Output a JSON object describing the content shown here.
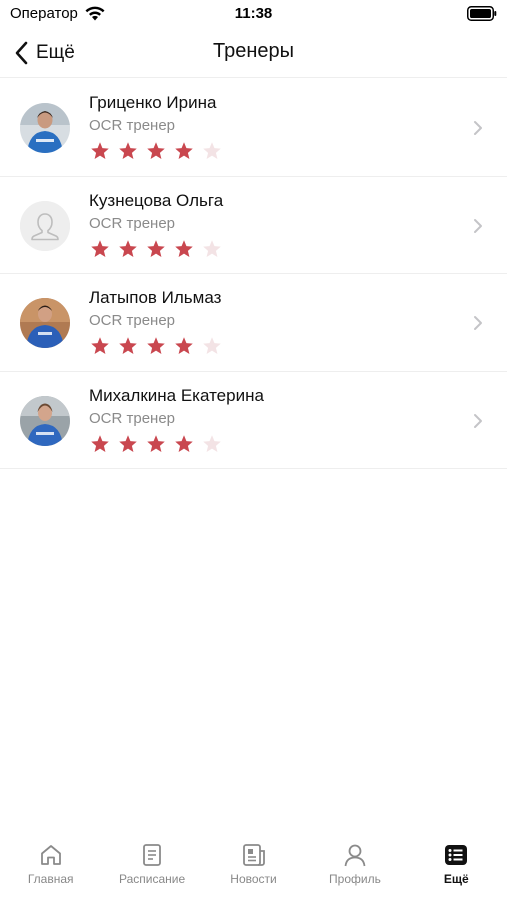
{
  "status_bar": {
    "carrier": "Оператор",
    "time": "11:38"
  },
  "nav": {
    "back_label": "Ещё",
    "title": "Тренеры"
  },
  "colors": {
    "star_filled": "#c9474f",
    "star_empty": "#f3e3e5",
    "divider": "#eeeeee",
    "secondary_text": "#8a8a8a"
  },
  "trainers": [
    {
      "name": "Гриценко Ирина",
      "role": "OCR тренер",
      "rating": 4,
      "max_rating": 5,
      "avatar": "photo"
    },
    {
      "name": "Кузнецова Ольга",
      "role": "OCR тренер",
      "rating": 4,
      "max_rating": 5,
      "avatar": "placeholder-person-icon"
    },
    {
      "name": "Латыпов Ильмаз",
      "role": "OCR тренер",
      "rating": 4,
      "max_rating": 5,
      "avatar": "photo"
    },
    {
      "name": "Михалкина Екатерина",
      "role": "OCR тренер",
      "rating": 4,
      "max_rating": 5,
      "avatar": "photo"
    }
  ],
  "tab_bar": {
    "tabs": [
      {
        "label": "Главная",
        "icon": "home-icon",
        "active": false
      },
      {
        "label": "Расписание",
        "icon": "schedule-icon",
        "active": false
      },
      {
        "label": "Новости",
        "icon": "news-icon",
        "active": false
      },
      {
        "label": "Профиль",
        "icon": "profile-icon",
        "active": false
      },
      {
        "label": "Ещё",
        "icon": "more-icon",
        "active": true
      }
    ]
  }
}
